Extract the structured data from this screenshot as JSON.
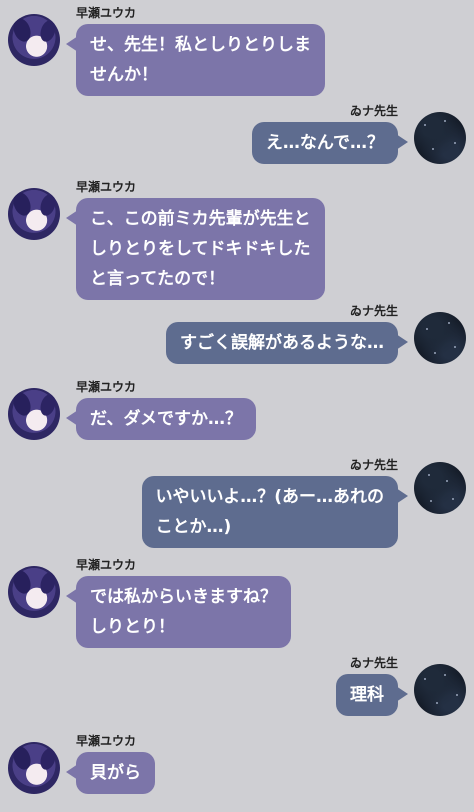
{
  "colors": {
    "background": "#cfcfd3",
    "left_bubble": "#7c75a9",
    "right_bubble": "#5e6c8f",
    "bubble_text": "#ffffff",
    "name_text": "#222222"
  },
  "messages": [
    {
      "sender": "早瀬ユウカ",
      "side": "left",
      "lines": [
        "せ、先生！私としりとりしま",
        "せんか！"
      ]
    },
    {
      "sender": "ゐナ先生",
      "side": "right",
      "lines": [
        "え…なんで…？"
      ]
    },
    {
      "sender": "早瀬ユウカ",
      "side": "left",
      "lines": [
        "こ、この前ミカ先輩が先生と",
        "しりとりをしてドキドキした",
        "と言ってたので！"
      ]
    },
    {
      "sender": "ゐナ先生",
      "side": "right",
      "lines": [
        "すごく誤解があるような…"
      ]
    },
    {
      "sender": "早瀬ユウカ",
      "side": "left",
      "lines": [
        "だ、ダメですか…？"
      ]
    },
    {
      "sender": "ゐナ先生",
      "side": "right",
      "lines": [
        "いやいいよ…？(あー…あれの",
        "ことか…)"
      ]
    },
    {
      "sender": "早瀬ユウカ",
      "side": "left",
      "lines": [
        "では私からいきますね？",
        "しりとり！"
      ]
    },
    {
      "sender": "ゐナ先生",
      "side": "right",
      "lines": [
        "理科"
      ]
    },
    {
      "sender": "早瀬ユウカ",
      "side": "left",
      "lines": [
        "貝がら"
      ]
    }
  ]
}
